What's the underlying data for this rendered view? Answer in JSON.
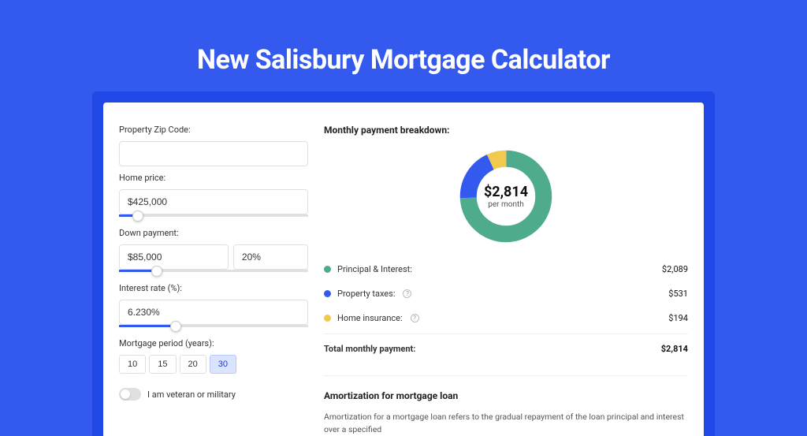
{
  "title": "New Salisbury Mortgage Calculator",
  "form": {
    "zip_label": "Property Zip Code:",
    "zip_value": "",
    "home_price_label": "Home price:",
    "home_price_value": "$425,000",
    "home_price_slider_pct": 10,
    "down_payment_label": "Down payment:",
    "down_payment_amount": "$85,000",
    "down_payment_pct": "20%",
    "down_payment_slider_pct": 20,
    "interest_label": "Interest rate (%):",
    "interest_value": "6.230%",
    "interest_slider_pct": 30,
    "period_label": "Mortgage period (years):",
    "period_options": [
      "10",
      "15",
      "20",
      "30"
    ],
    "period_selected_index": 3,
    "veteran_label": "I am veteran or military",
    "veteran_on": false
  },
  "breakdown": {
    "title": "Monthly payment breakdown:",
    "center_amount": "$2,814",
    "center_sub": "per month",
    "items": [
      {
        "label": "Principal & Interest:",
        "value": "$2,089",
        "color": "#4eab8b",
        "info": false
      },
      {
        "label": "Property taxes:",
        "value": "$531",
        "color": "#3359ef",
        "info": true
      },
      {
        "label": "Home insurance:",
        "value": "$194",
        "color": "#f0c94e",
        "info": true
      }
    ],
    "total_label": "Total monthly payment:",
    "total_value": "$2,814"
  },
  "amort": {
    "title": "Amortization for mortgage loan",
    "text": "Amortization for a mortgage loan refers to the gradual repayment of the loan principal and interest over a specified"
  },
  "chart_data": {
    "type": "pie",
    "title": "Monthly payment breakdown",
    "categories": [
      "Principal & Interest",
      "Property taxes",
      "Home insurance"
    ],
    "values": [
      2089,
      531,
      194
    ],
    "colors": [
      "#4eab8b",
      "#3359ef",
      "#f0c94e"
    ],
    "center_label": "$2,814 per month"
  }
}
